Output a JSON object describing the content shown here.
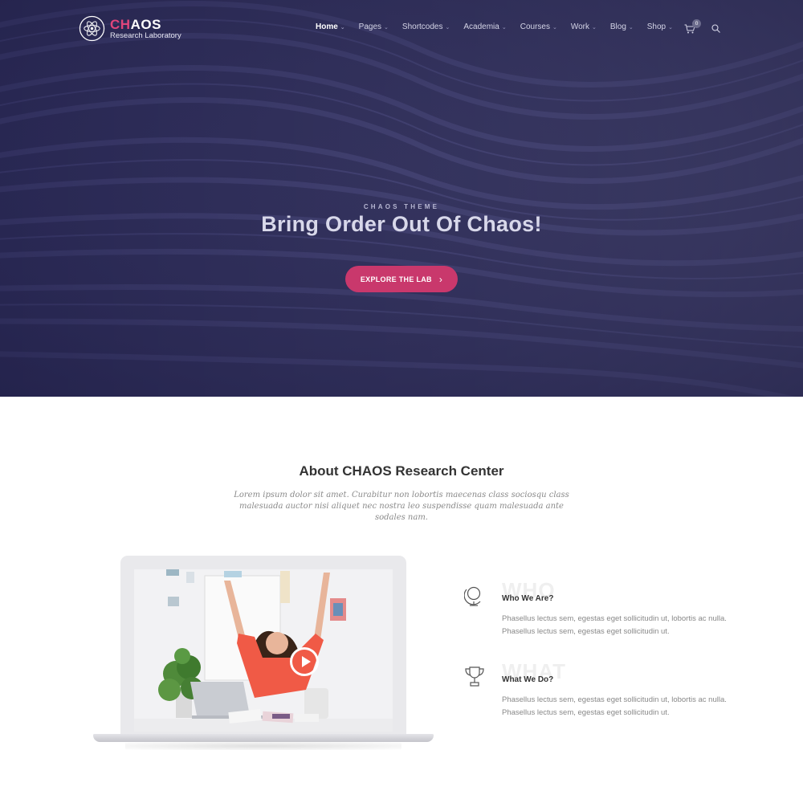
{
  "brand": {
    "title_accent": "CH",
    "title_rest": "AOS",
    "subtitle": "Research Laboratory",
    "icon": "atom-icon"
  },
  "nav": {
    "items": [
      {
        "label": "Home"
      },
      {
        "label": "Pages"
      },
      {
        "label": "Shortcodes"
      },
      {
        "label": "Academia"
      },
      {
        "label": "Courses"
      },
      {
        "label": "Work"
      },
      {
        "label": "Blog"
      },
      {
        "label": "Shop"
      }
    ],
    "cart_icon": "cart-icon",
    "cart_count": "0",
    "search_icon": "search-icon"
  },
  "hero": {
    "kicker": "CHAOS THEME",
    "title": "Bring Order Out Of Chaos!",
    "button_label": "EXPLORE THE LAB",
    "button_icon": "chevron-right-icon"
  },
  "about": {
    "title": "About CHAOS Research Center",
    "text": "Lorem ipsum dolor sit amet. Curabitur non lobortis maecenas class sociosqu class malesuada auctor nisi aliquet nec nostra leo suspendisse quam malesuada ante sodales nam.",
    "video_icon": "play-icon"
  },
  "features": [
    {
      "icon": "globe-icon",
      "bg_word": "WHO",
      "title": "Who We Are?",
      "text": "Phasellus lectus sem, egestas eget sollicitudin ut, lobortis ac nulla. Phasellus lectus sem, egestas eget sollicitudin ut."
    },
    {
      "icon": "trophy-icon",
      "bg_word": "WHAT",
      "title": "What We Do?",
      "text": "Phasellus lectus sem, egestas eget sollicitudin ut, lobortis ac nulla. Phasellus lectus sem, egestas eget sollicitudin ut."
    }
  ],
  "colors": {
    "hero_bg": "#2b2a56",
    "accent": "#c9386c",
    "logo_accent": "#e0457b"
  }
}
